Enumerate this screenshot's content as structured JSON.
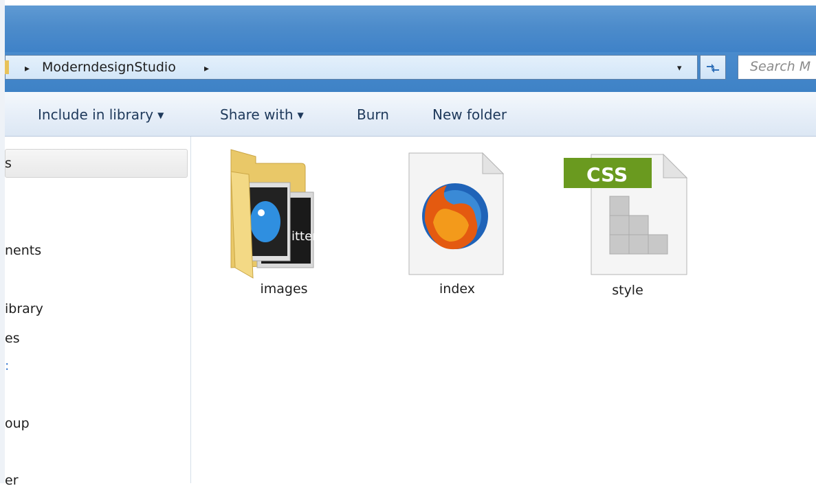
{
  "address": {
    "breadcrumb": "ModerndesignStudio",
    "arrow_left": "▸",
    "arrow_right": "▸",
    "dropdown": "▾"
  },
  "search": {
    "placeholder": "Search M"
  },
  "commands": {
    "include_in_library": "Include in library",
    "share_with": "Share with",
    "burn": "Burn",
    "new_folder": "New folder",
    "caret": "▼"
  },
  "nav": {
    "items": [
      {
        "label": "s"
      },
      {
        "label": "nents"
      },
      {
        "label": "ibrary"
      },
      {
        "label": "es"
      },
      {
        "label": ":"
      },
      {
        "label": "oup"
      },
      {
        "label": "er"
      }
    ]
  },
  "files": [
    {
      "name": "images",
      "type": "folder",
      "icon": "folder-icon"
    },
    {
      "name": "index",
      "type": "html",
      "icon": "firefox-icon"
    },
    {
      "name": "style",
      "type": "css",
      "icon": "css-file-icon",
      "badge": "CSS"
    }
  ],
  "colors": {
    "titlebar": "#4d8ccb",
    "css_badge": "#6a9a1f",
    "link_blue": "#3d7bd1"
  }
}
